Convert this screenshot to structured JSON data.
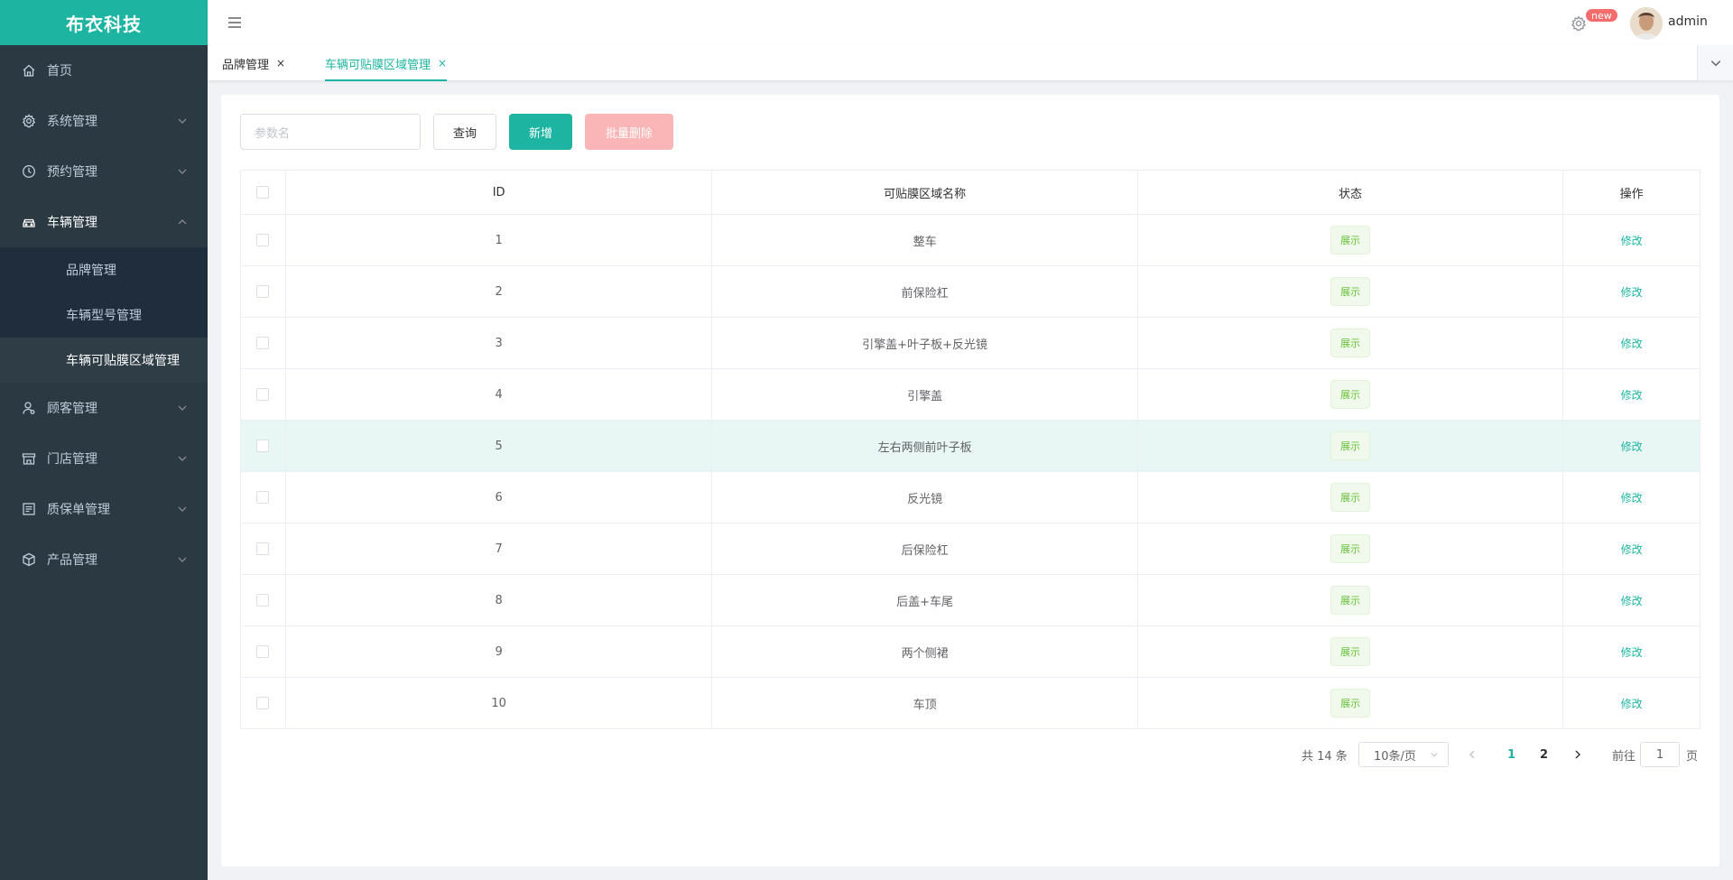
{
  "sidebar": {
    "logo": "布衣科技",
    "items": [
      {
        "label": "首页",
        "icon": "home-icon"
      },
      {
        "label": "系统管理",
        "icon": "gear-icon"
      },
      {
        "label": "预约管理",
        "icon": "clock-icon"
      },
      {
        "label": "车辆管理",
        "icon": "car-icon"
      },
      {
        "label": "顾客管理",
        "icon": "user-icon"
      },
      {
        "label": "门店管理",
        "icon": "store-icon"
      },
      {
        "label": "质保单管理",
        "icon": "document-icon"
      },
      {
        "label": "产品管理",
        "icon": "box-icon"
      }
    ],
    "vehicle_sub": [
      "品牌管理",
      "车辆型号管理",
      "车辆可贴膜区域管理"
    ]
  },
  "header": {
    "badge": "new",
    "username": "admin"
  },
  "tabs": [
    {
      "label": "品牌管理",
      "close": "×"
    },
    {
      "label": "车辆可贴膜区域管理",
      "close": "×"
    }
  ],
  "toolbar": {
    "search_placeholder": "参数名",
    "query_label": "查询",
    "add_label": "新增",
    "bulk_delete_label": "批量删除"
  },
  "table": {
    "headers": [
      "ID",
      "可贴膜区域名称",
      "状态",
      "操作"
    ],
    "rows": [
      {
        "id": "1",
        "name": "整车",
        "status": "展示",
        "op": "修改"
      },
      {
        "id": "2",
        "name": "前保险杠",
        "status": "展示",
        "op": "修改"
      },
      {
        "id": "3",
        "name": "引擎盖+叶子板+反光镜",
        "status": "展示",
        "op": "修改"
      },
      {
        "id": "4",
        "name": "引擎盖",
        "status": "展示",
        "op": "修改"
      },
      {
        "id": "5",
        "name": "左右两侧前叶子板",
        "status": "展示",
        "op": "修改"
      },
      {
        "id": "6",
        "name": "反光镜",
        "status": "展示",
        "op": "修改"
      },
      {
        "id": "7",
        "name": "后保险杠",
        "status": "展示",
        "op": "修改"
      },
      {
        "id": "8",
        "name": "后盖+车尾",
        "status": "展示",
        "op": "修改"
      },
      {
        "id": "9",
        "name": "两个侧裙",
        "status": "展示",
        "op": "修改"
      },
      {
        "id": "10",
        "name": "车顶",
        "status": "展示",
        "op": "修改"
      }
    ]
  },
  "pagination": {
    "total": "共 14 条",
    "page_size": "10条/页",
    "pages": [
      "1",
      "2"
    ],
    "current_page": "1",
    "goto_label": "前往",
    "goto_value": "1",
    "page_suffix": "页"
  },
  "colors": {
    "accent": "#1db5a1",
    "sidebar_bg": "#2b3a42",
    "danger_light": "#fab6b6",
    "badge": "#f56c6c"
  }
}
